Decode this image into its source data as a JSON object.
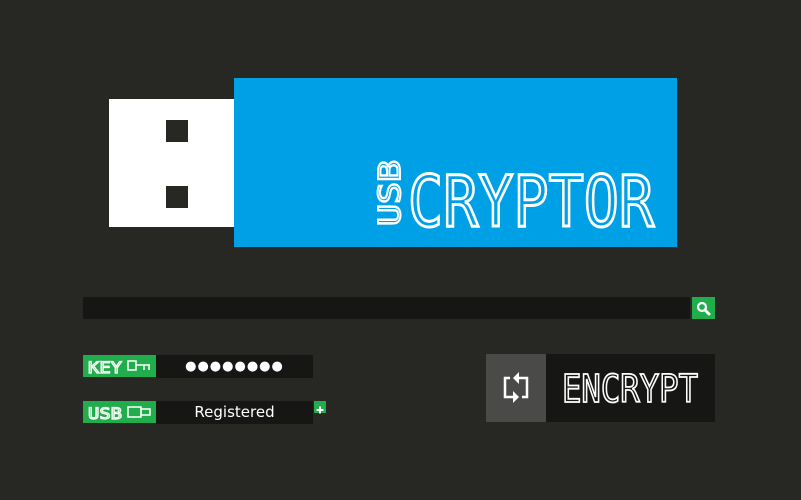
{
  "app": {
    "logo_prefix": "USB",
    "logo_name": "CRYPTOR"
  },
  "path_bar": {
    "value": "",
    "browse_icon": "search-icon"
  },
  "key": {
    "label": "KEY",
    "icon": "key-icon",
    "value": "●●●●●●●●"
  },
  "usb": {
    "label": "USB",
    "icon": "usb-plug-icon",
    "status": "Registered",
    "add_icon": "plus-icon"
  },
  "encrypt": {
    "label": "ENCRYPT",
    "icon": "refresh-icon"
  },
  "colors": {
    "background": "#272723",
    "brand_blue": "#00a0e6",
    "accent_green": "#21ad4b",
    "field_dark": "#161614",
    "icon_box_gray": "#4a4a48"
  }
}
